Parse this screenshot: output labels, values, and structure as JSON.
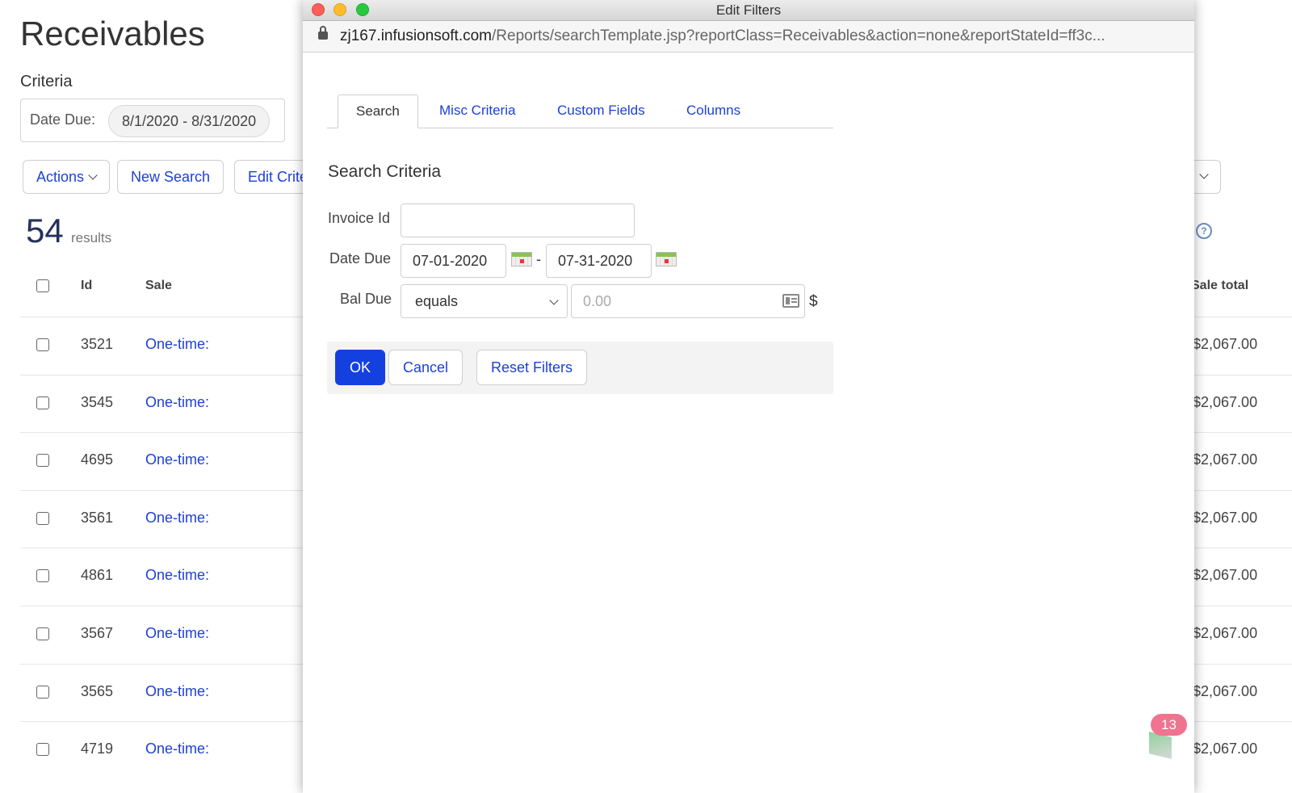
{
  "page": {
    "title": "Receivables",
    "criteria_heading": "Criteria",
    "criteria": {
      "label": "Date Due:",
      "value": "8/1/2020 - 8/31/2020"
    },
    "toolbar": {
      "actions": "Actions",
      "new_search": "New Search",
      "edit_criteria": "Edit Criteria"
    },
    "results": {
      "count": "54",
      "label": "results"
    },
    "table": {
      "headers": {
        "id": "Id",
        "sale": "Sale",
        "sale_total": "Sale total"
      },
      "rows": [
        {
          "id": "3521",
          "sale": "One-time:",
          "total": "$2,067.00"
        },
        {
          "id": "3545",
          "sale": "One-time:",
          "total": "$2,067.00"
        },
        {
          "id": "4695",
          "sale": "One-time:",
          "total": "$2,067.00"
        },
        {
          "id": "3561",
          "sale": "One-time:",
          "total": "$2,067.00"
        },
        {
          "id": "4861",
          "sale": "One-time:",
          "total": "$2,067.00"
        },
        {
          "id": "3567",
          "sale": "One-time:",
          "total": "$2,067.00"
        },
        {
          "id": "3565",
          "sale": "One-time:",
          "total": "$2,067.00"
        },
        {
          "id": "4719",
          "sale": "One-time:",
          "total": "$2,067.00"
        }
      ]
    }
  },
  "modal": {
    "window_title": "Edit Filters",
    "url_host": "zj167.infusionsoft.com",
    "url_path": "/Reports/searchTemplate.jsp?reportClass=Receivables&action=none&reportStateId=ff3c...",
    "tabs": [
      "Search",
      "Misc Criteria",
      "Custom Fields",
      "Columns"
    ],
    "section_title": "Search Criteria",
    "fields": {
      "invoice_id": {
        "label": "Invoice Id",
        "value": ""
      },
      "date_due": {
        "label": "Date Due",
        "from": "07-01-2020",
        "separator": "-",
        "to": "07-31-2020"
      },
      "bal_due": {
        "label": "Bal Due",
        "operator": "equals",
        "placeholder": "0.00",
        "currency": "$"
      }
    },
    "buttons": {
      "ok": "OK",
      "cancel": "Cancel",
      "reset": "Reset Filters"
    }
  },
  "widget": {
    "badge_count": "13"
  },
  "colors": {
    "link": "#1d3fd8",
    "primary_button": "#1540e0",
    "badge": "#f07391"
  }
}
